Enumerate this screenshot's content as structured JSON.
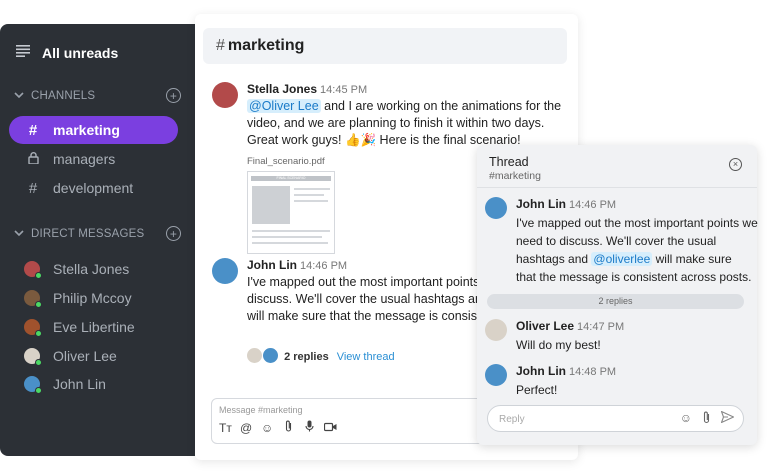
{
  "sidebar": {
    "title": "All unreads",
    "channels_heading": "CHANNELS",
    "channels": [
      {
        "name": "marketing",
        "icon": "hash-icon",
        "active": true
      },
      {
        "name": "managers",
        "icon": "lock-icon",
        "active": false
      },
      {
        "name": "development",
        "icon": "hash-icon",
        "active": false
      }
    ],
    "dm_heading": "DIRECT MESSAGES",
    "dms": [
      {
        "name": "Stella Jones"
      },
      {
        "name": "Philip Mccoy"
      },
      {
        "name": "Eve Libertine"
      },
      {
        "name": "Oliver Lee"
      },
      {
        "name": "John Lin"
      }
    ]
  },
  "main": {
    "channel_title": "marketing",
    "messages": [
      {
        "author": "Stella Jones",
        "time": "14:45 PM",
        "mention": "@Oliver Lee",
        "line1_rest": " and I are working on the animations for the",
        "line2": "video, and we are planning to finish it within two days.",
        "line3": "Great work guys! 👍🎉  Here is the final scenario!",
        "attachment": {
          "file_name": "Final_scenario.pdf",
          "preview_title": "FINAL SCENARIO"
        }
      },
      {
        "author": "John Lin",
        "time": "14:46 PM",
        "line1": "I've mapped out the most important points w",
        "line2": "discuss. We'll cover the usual hashtags and",
        "line3": "will make sure that the message is consister"
      }
    ],
    "replies_count": "2 replies",
    "view_thread": "View thread",
    "composer_placeholder": "Message #marketing"
  },
  "thread": {
    "title": "Thread",
    "channel": "#marketing",
    "messages": [
      {
        "author": "John Lin",
        "time": "14:46 PM",
        "line1": "I've mapped out the most important points we",
        "line2": "need to discuss. We'll cover the usual",
        "line3_pre": "hashtags and ",
        "mention": "@oliverlee",
        "line3_post": " will make sure",
        "line4": "that the message is consistent across posts."
      },
      {
        "author": "Oliver Lee",
        "time": "14:47 PM",
        "text": "Will do my best!"
      },
      {
        "author": "John Lin",
        "time": "14:48 PM",
        "text": "Perfect!"
      }
    ],
    "replies_pill": "2 replies",
    "reply_placeholder": "Reply"
  },
  "colors": {
    "sidebar_bg": "#2c3036",
    "accent": "#7b3fe0",
    "mention_bg": "#d6eefc",
    "link": "#2a8fd4",
    "online": "#4cd964"
  }
}
